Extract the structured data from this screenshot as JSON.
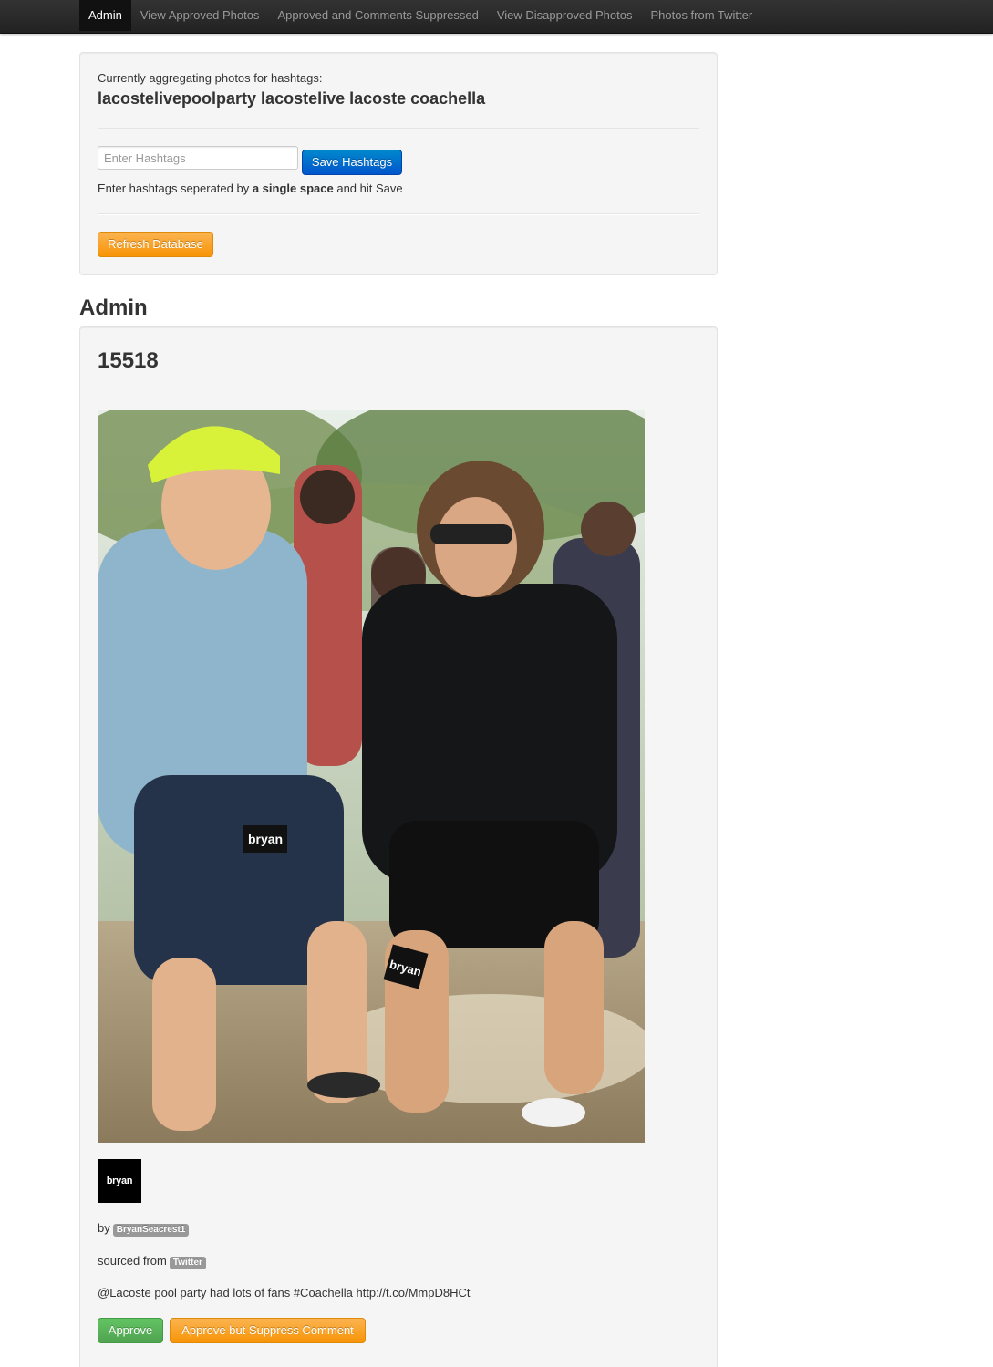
{
  "navbar": {
    "items": [
      {
        "label": "Admin",
        "active": true
      },
      {
        "label": "View Approved Photos",
        "active": false
      },
      {
        "label": "Approved and Comments Suppressed",
        "active": false
      },
      {
        "label": "View Disapproved Photos",
        "active": false
      },
      {
        "label": "Photos from Twitter",
        "active": false
      }
    ]
  },
  "hashtags": {
    "label": "Currently aggregating photos for hashtags:",
    "value": "lacostelivepoolparty lacostelive lacoste coachella",
    "input_placeholder": "Enter Hashtags",
    "input_value": "",
    "save_label": "Save Hashtags",
    "help_prefix": "Enter hashtags seperated by ",
    "help_bold": "a single space",
    "help_suffix": " and hit Save",
    "refresh_label": "Refresh Database"
  },
  "section": {
    "title": "Admin"
  },
  "photo": {
    "id": "15518",
    "avatar_text": "bryan",
    "by_label": "by",
    "author": "BryanSeacrest1",
    "sourced_label": "sourced from",
    "source": "Twitter",
    "caption": "@Lacoste pool party had lots of fans #Coachella http://t.co/MmpD8HCt",
    "approve_label": "Approve",
    "approve_suppress_label": "Approve but Suppress Comment",
    "image_overlay_text": "bryan"
  },
  "colors": {
    "navbar_bg": "#222222",
    "primary": "#0074cc",
    "warning": "#f89406",
    "success": "#51a351",
    "badge": "#999999",
    "well_bg": "#f5f5f5"
  }
}
